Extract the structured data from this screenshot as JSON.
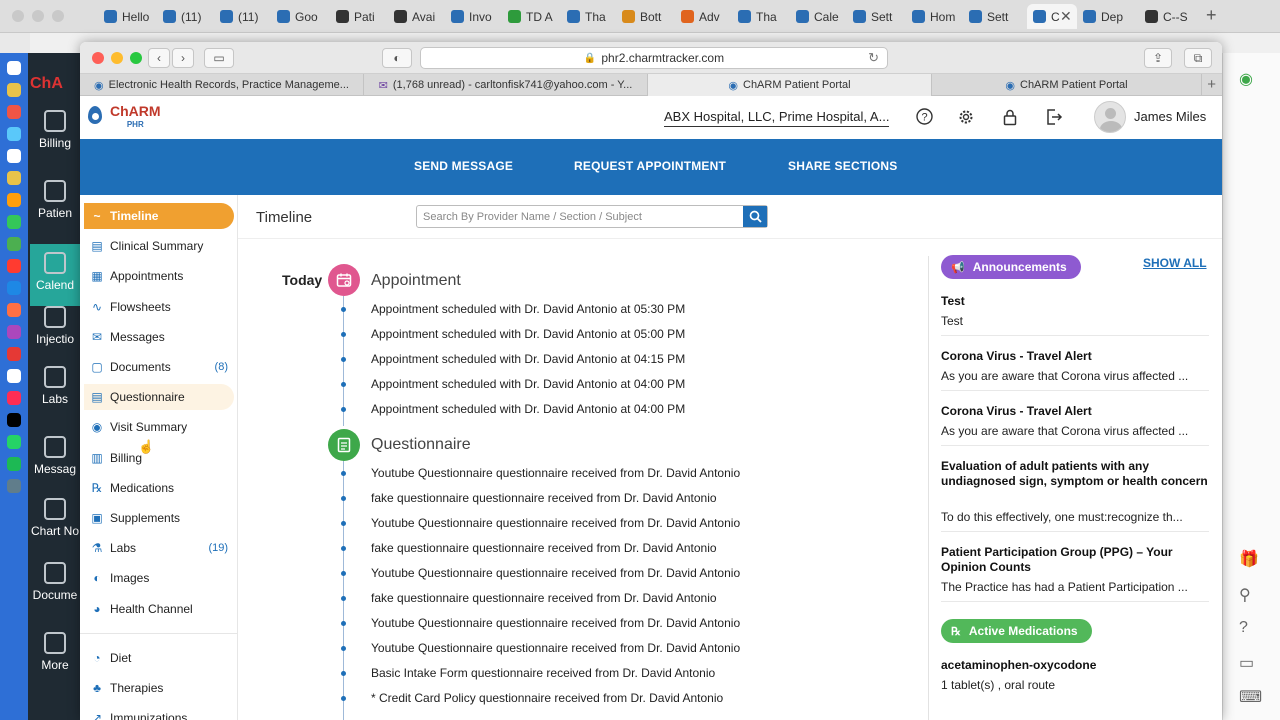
{
  "outer_tabs": [
    {
      "label": "Hello",
      "color": "#2b6db3"
    },
    {
      "label": "(11)",
      "color": "#2b6db3"
    },
    {
      "label": "(11)",
      "color": "#2b6db3"
    },
    {
      "label": "Goo",
      "color": "#2b6db3"
    },
    {
      "label": "Pati",
      "color": "#333333"
    },
    {
      "label": "Avai",
      "color": "#333333"
    },
    {
      "label": "Invo",
      "color": "#2b6db3"
    },
    {
      "label": "TD A",
      "color": "#2e9b3c"
    },
    {
      "label": "Tha",
      "color": "#2b6db3"
    },
    {
      "label": "Bott",
      "color": "#d88a1b"
    },
    {
      "label": "Adv",
      "color": "#e0641e"
    },
    {
      "label": "Tha",
      "color": "#2b6db3"
    },
    {
      "label": "Cale",
      "color": "#2b6db3"
    },
    {
      "label": "Sett",
      "color": "#2b6db3"
    },
    {
      "label": "Hom",
      "color": "#2b6db3"
    },
    {
      "label": "Sett",
      "color": "#2b6db3"
    },
    {
      "label": "C",
      "color": "#2b6db3"
    },
    {
      "label": "Dep",
      "color": "#2b6db3"
    },
    {
      "label": "C--S",
      "color": "#333333"
    }
  ],
  "bg_app": {
    "logo": "ChA",
    "items": [
      "Billing",
      "Patien",
      "Calend",
      "Injectio",
      "Labs",
      "Messag",
      "Chart No",
      "Docume",
      "More"
    ]
  },
  "browser": {
    "url": "phr2.charmtracker.com",
    "tabs": [
      "Electronic Health Records, Practice Manageme...",
      "(1,768 unread) - carltonfisk741@yahoo.com - Y...",
      "ChARM Patient Portal",
      "ChARM Patient Portal"
    ]
  },
  "header": {
    "logo_main": "ChARM",
    "logo_sub": "PHR",
    "facility": "ABX Hospital, LLC, Prime Hospital, A...",
    "user_name": "James Miles"
  },
  "actions": [
    "SEND MESSAGE",
    "REQUEST APPOINTMENT",
    "SHARE SECTIONS"
  ],
  "sidebar": {
    "items": [
      {
        "label": "Timeline",
        "icon": "~",
        "count": ""
      },
      {
        "label": "Clinical Summary",
        "icon": "▤",
        "count": ""
      },
      {
        "label": "Appointments",
        "icon": "▦",
        "count": ""
      },
      {
        "label": "Flowsheets",
        "icon": "∿",
        "count": ""
      },
      {
        "label": "Messages",
        "icon": "✉",
        "count": ""
      },
      {
        "label": "Documents",
        "icon": "▢",
        "count": "(8)"
      },
      {
        "label": "Questionnaire",
        "icon": "▤",
        "count": ""
      },
      {
        "label": "Visit Summary",
        "icon": "◉",
        "count": ""
      },
      {
        "label": "Billing",
        "icon": "▥",
        "count": ""
      },
      {
        "label": "Medications",
        "icon": "℞",
        "count": ""
      },
      {
        "label": "Supplements",
        "icon": "▣",
        "count": ""
      },
      {
        "label": "Labs",
        "icon": "⚗",
        "count": "(19)"
      },
      {
        "label": "Images",
        "icon": "◐",
        "count": ""
      },
      {
        "label": "Health Channel",
        "icon": "◕",
        "count": ""
      },
      {
        "label": "Diet",
        "icon": "◔",
        "count": ""
      },
      {
        "label": "Therapies",
        "icon": "♣",
        "count": ""
      },
      {
        "label": "Immunizations",
        "icon": "↗",
        "count": ""
      }
    ]
  },
  "main": {
    "title": "Timeline",
    "search_placeholder": "Search By Provider Name / Section / Subject",
    "today_label": "Today",
    "appointment_title": "Appointment",
    "appointment_color": "#e0578f",
    "appointments": [
      "Appointment scheduled with Dr. David Antonio at 05:30 PM",
      "Appointment scheduled with Dr. David Antonio at 05:00 PM",
      "Appointment scheduled with Dr. David Antonio at 04:15 PM",
      "Appointment scheduled with Dr. David Antonio at 04:00 PM",
      "Appointment scheduled with Dr. David Antonio at 04:00 PM"
    ],
    "questionnaire_title": "Questionnaire",
    "questionnaire_color": "#3ea84a",
    "questionnaires": [
      "Youtube Questionnaire questionnaire received from Dr. David Antonio",
      "fake questionnaire questionnaire received from Dr. David Antonio",
      "Youtube Questionnaire questionnaire received from Dr. David Antonio",
      "fake questionnaire questionnaire received from Dr. David Antonio",
      "Youtube Questionnaire questionnaire received from Dr. David Antonio",
      "fake questionnaire questionnaire received from Dr. David Antonio",
      "Youtube Questionnaire questionnaire received from Dr. David Antonio",
      "Youtube Questionnaire questionnaire received from Dr. David Antonio",
      "Basic Intake Form questionnaire received from Dr. David Antonio",
      "* Credit Card Policy questionnaire received from Dr. David Antonio"
    ]
  },
  "announcements": {
    "label": "Announcements",
    "color": "#8e5ad1",
    "show_all": "SHOW ALL",
    "items": [
      {
        "title": "Test",
        "body": "Test"
      },
      {
        "title": "Corona Virus - Travel Alert",
        "body": "As you are aware that Corona virus affected ..."
      },
      {
        "title": "Corona Virus - Travel Alert",
        "body": "As you are aware that Corona virus affected ..."
      },
      {
        "title": "Evaluation of adult patients with any undiagnosed sign, symptom or health concern",
        "body": "To do this effectively, one must:recognize th..."
      },
      {
        "title": "Patient Participation Group (PPG) – Your Opinion Counts",
        "body": "The Practice has had a Patient Participation ..."
      }
    ]
  },
  "active_medications": {
    "label": "Active Medications",
    "color": "#52b85a",
    "items": [
      {
        "name": "acetaminophen-oxycodone",
        "detail": "1 tablet(s) , oral route"
      }
    ]
  }
}
